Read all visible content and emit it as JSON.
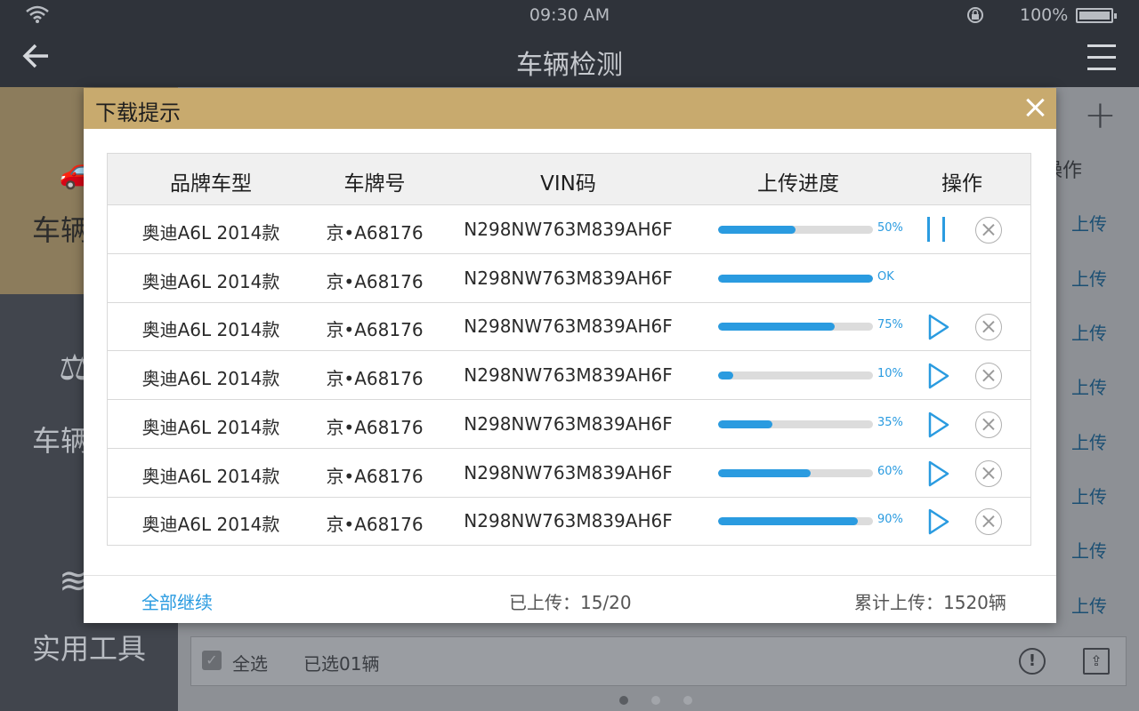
{
  "status": {
    "time": "09:30  AM",
    "battery": "100%"
  },
  "header": {
    "title": "车辆检测"
  },
  "sidebar": {
    "items": [
      {
        "label": "车辆"
      },
      {
        "label": "车辆"
      },
      {
        "label": "实用工具"
      }
    ]
  },
  "background": {
    "ops_header": "操作",
    "upload_label": "上传",
    "select_all": "全选",
    "selected_count": "已选01辆"
  },
  "dialog": {
    "title": "下载提示",
    "columns": [
      "品牌车型",
      "车牌号",
      "VIN码",
      "上传进度",
      "操作"
    ],
    "rows": [
      {
        "model": "奥迪A6L  2014款",
        "plate": "京•A68176",
        "vin": "N298NW763M839AH6F",
        "progress": 0.5,
        "progress_label": "50%",
        "action": "pause"
      },
      {
        "model": "奥迪A6L  2014款",
        "plate": "京•A68176",
        "vin": "N298NW763M839AH6F",
        "progress": 1.0,
        "progress_label": "OK",
        "action": "none"
      },
      {
        "model": "奥迪A6L  2014款",
        "plate": "京•A68176",
        "vin": "N298NW763M839AH6F",
        "progress": 0.75,
        "progress_label": "75%",
        "action": "play"
      },
      {
        "model": "奥迪A6L  2014款",
        "plate": "京•A68176",
        "vin": "N298NW763M839AH6F",
        "progress": 0.1,
        "progress_label": "10%",
        "action": "play"
      },
      {
        "model": "奥迪A6L  2014款",
        "plate": "京•A68176",
        "vin": "N298NW763M839AH6F",
        "progress": 0.35,
        "progress_label": "35%",
        "action": "play"
      },
      {
        "model": "奥迪A6L  2014款",
        "plate": "京•A68176",
        "vin": "N298NW763M839AH6F",
        "progress": 0.6,
        "progress_label": "60%",
        "action": "play"
      },
      {
        "model": "奥迪A6L  2014款",
        "plate": "京•A68176",
        "vin": "N298NW763M839AH6F",
        "progress": 0.9,
        "progress_label": "90%",
        "action": "play"
      }
    ],
    "footer": {
      "resume_all": "全部继续",
      "uploaded": "已上传：15/20",
      "total": "累计上传：1520辆"
    }
  },
  "colors": {
    "accent": "#2a9be0",
    "dialog_header": "#c8aa6e"
  },
  "icons": [
    "wifi-icon",
    "lock-icon",
    "battery-icon",
    "back-arrow-icon",
    "menu-icon",
    "close-icon",
    "pause-icon",
    "play-icon",
    "cancel-icon",
    "plus-icon",
    "warning-icon",
    "export-icon"
  ]
}
